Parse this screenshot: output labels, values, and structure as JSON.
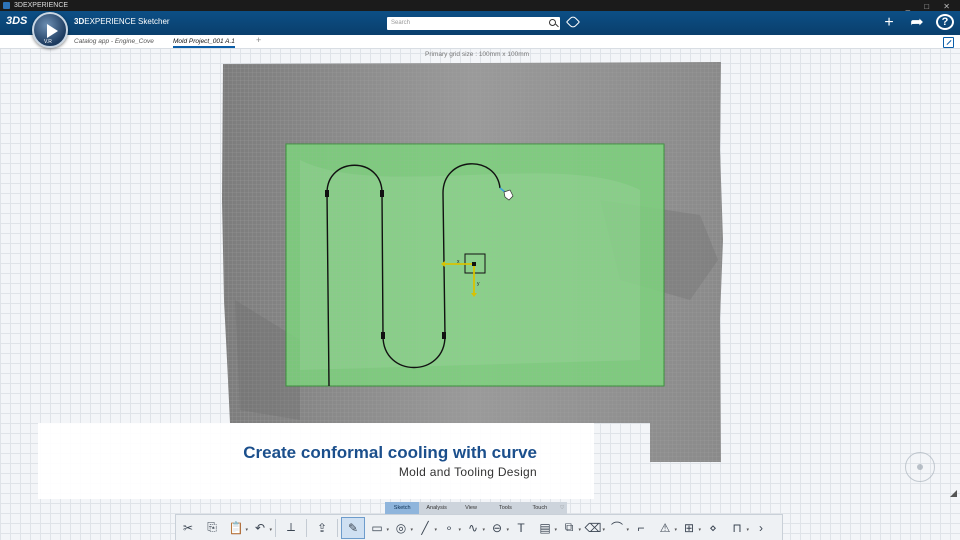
{
  "os_bar": {
    "title": "3DEXPERIENCE",
    "controls": "_ □ ✕"
  },
  "header": {
    "brand": "3DS",
    "compass_label": "V.R",
    "app_prefix": "3D",
    "app_title": "EXPERIENCE Sketcher",
    "search_placeholder": "Search",
    "icons": [
      "search-icon",
      "tag-icon",
      "plus-icon",
      "share-icon",
      "help-icon"
    ]
  },
  "tabs": [
    {
      "label": "Catalog app - Engine_Cove",
      "active": false
    },
    {
      "label": "Mold Project_001 A.1",
      "active": true
    }
  ],
  "tab_add": "+",
  "canvas": {
    "grid_info": "Primary grid size : 100mm x 100mm",
    "origin_axis_y": "y",
    "origin_axis_x": "x"
  },
  "caption": {
    "title": "Create conformal cooling with curve",
    "subtitle": "Mold and Tooling  Design"
  },
  "action_tabs": [
    {
      "label": "Sketch",
      "selected": true
    },
    {
      "label": "Analysis",
      "selected": false
    },
    {
      "label": "View",
      "selected": false
    },
    {
      "label": "Tools",
      "selected": false
    },
    {
      "label": "Touch",
      "selected": false
    }
  ],
  "toolbar": {
    "groups": [
      [
        "cut-icon",
        "copy-icon",
        "paste-icon",
        "undo-icon"
      ],
      [
        "sketch-plane-icon"
      ],
      [
        "export-icon"
      ],
      [
        "profile-icon",
        "rectangle-icon",
        "circle-icon",
        "line-icon",
        "point-icon",
        "spline-icon",
        "slot-icon",
        "text-icon",
        "keep-icon",
        "dimension-icon",
        "eraser-icon",
        "corner-icon",
        "chamfer-icon",
        "warning-icon",
        "stamp-icon",
        "symmetry-icon",
        "constraint-icon",
        "more-icon"
      ]
    ],
    "glyphs": {
      "cut-icon": "✂",
      "copy-icon": "⎘",
      "paste-icon": "📋",
      "undo-icon": "↶",
      "sketch-plane-icon": "⟂",
      "export-icon": "⇪",
      "profile-icon": "✎",
      "rectangle-icon": "▭",
      "circle-icon": "◎",
      "line-icon": "╱",
      "point-icon": "∘",
      "spline-icon": "∿",
      "slot-icon": "⊖",
      "text-icon": "T",
      "keep-icon": "▤",
      "dimension-icon": "⧉",
      "eraser-icon": "⌫",
      "corner-icon": "⌒",
      "chamfer-icon": "⌐",
      "warning-icon": "⚠",
      "stamp-icon": "⊞",
      "symmetry-icon": "⋄",
      "constraint-icon": "⊓",
      "more-icon": "›"
    }
  },
  "colors": {
    "header_blue": "#0c4f86",
    "selection_green": "#7bd77b",
    "mold_gray": "#8c8c8c",
    "caption_title": "#1b4f8c"
  }
}
